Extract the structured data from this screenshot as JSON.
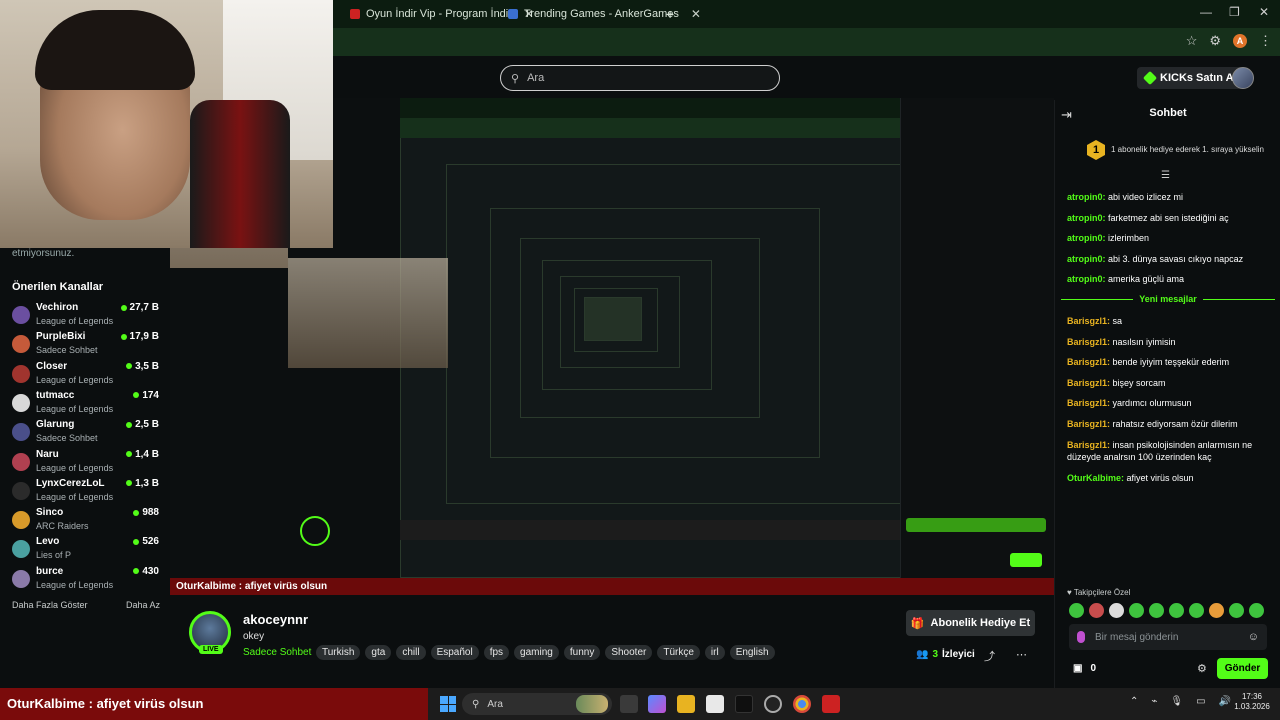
{
  "browser": {
    "tabs": [
      {
        "label": "Oyun İndir Vip - Program İndir",
        "close": "✕"
      },
      {
        "label": "Trending Games - AnkerGames",
        "close": "✕"
      }
    ],
    "new_tab": "+",
    "win_min": "—",
    "win_max": "❐",
    "win_close": "✕",
    "profile_initial": "A"
  },
  "header": {
    "search_placeholder": "Ara",
    "kicks_label": "KICKs Satın Al"
  },
  "sidebar": {
    "cut_text": "etmiyorsunuz.",
    "title": "Önerilen Kanallar",
    "channels": [
      {
        "name": "Vechiron",
        "game": "League of Legends",
        "viewers": "27,7 B",
        "color": "#6b4fa0"
      },
      {
        "name": "PurpleBixi",
        "game": "Sadece Sohbet",
        "viewers": "17,9 B",
        "color": "#c55a3a"
      },
      {
        "name": "Closer",
        "game": "League of Legends",
        "viewers": "3,5 B",
        "color": "#a0342e"
      },
      {
        "name": "tutmacc",
        "game": "League of Legends",
        "viewers": "174",
        "color": "#d8d8d8"
      },
      {
        "name": "Glarung",
        "game": "Sadece Sohbet",
        "viewers": "2,5 B",
        "color": "#4a4f8a"
      },
      {
        "name": "Naru",
        "game": "League of Legends",
        "viewers": "1,4 B",
        "color": "#b04050"
      },
      {
        "name": "LynxCerezLoL",
        "game": "League of Legends",
        "viewers": "1,3 B",
        "color": "#2b2b2b"
      },
      {
        "name": "Sinco",
        "game": "ARC Raiders",
        "viewers": "988",
        "color": "#d89a2a"
      },
      {
        "name": "Levo",
        "game": "Lies of P",
        "viewers": "526",
        "color": "#4aa0a0"
      },
      {
        "name": "burce",
        "game": "League of Legends",
        "viewers": "430",
        "color": "#8a7aa8"
      }
    ],
    "show_more": "Daha Fazla Göster",
    "show_less": "Daha Az"
  },
  "stream": {
    "overlay_text": "OturKalbime : afiyet virüs olsun"
  },
  "channel": {
    "name": "akoceynnr",
    "title": "okey",
    "live": "LIVE",
    "category": "Sadece Sohbet",
    "tags": [
      "Turkish",
      "gta",
      "chill",
      "Español",
      "fps",
      "gaming",
      "funny",
      "Shooter",
      "Türkçe",
      "irl",
      "English"
    ],
    "gift_label": "Abonelik Hediye Et",
    "viewer_count": "3",
    "viewer_label": "İzleyici"
  },
  "chat": {
    "title": "Sohbet",
    "pinned_badge": "1",
    "pinned_text": "1 abonelik hediye ederek 1. sıraya yükselin",
    "messages_before": [
      {
        "user": "atropin0",
        "text": "abi video izlicez mi"
      },
      {
        "user": "atropin0",
        "text": "farketmez abi sen istediğini aç"
      },
      {
        "user": "atropin0",
        "text": "izlerimben"
      },
      {
        "user": "atropin0",
        "text": "abi 3. dünya savası cıkıyo napcaz"
      },
      {
        "user": "atropin0",
        "text": "amerika güçlü ama"
      }
    ],
    "new_messages_label": "Yeni mesajlar",
    "messages_after": [
      {
        "user": "Barisgzl1",
        "text": "sa"
      },
      {
        "user": "Barisgzl1",
        "text": "nasılsın iyimisin"
      },
      {
        "user": "Barisgzl1",
        "text": "bende iyiyim teşşekür ederim"
      },
      {
        "user": "Barisgzl1",
        "text": "bişey sorcam"
      },
      {
        "user": "Barisgzl1",
        "text": "yardımcı olurmusun"
      },
      {
        "user": "Barisgzl1",
        "text": "rahatsız ediyorsam özür dilerim"
      },
      {
        "user": "Barisgzl1",
        "text": "insan psikolojisinden anlarmısın ne düzeyde analrsın 100 üzerinden kaç"
      },
      {
        "user": "OturKalbime",
        "text": "afiyet virüs olsun"
      }
    ],
    "favorites_label": "♥ Takipçilere Özel",
    "input_placeholder": "Bir mesaj gönderin",
    "kicks_count": "0",
    "send_label": "Gönder"
  },
  "taskbar": {
    "overlay_text": "OturKalbime : afiyet virüs olsun",
    "search_label": "Ara",
    "time": "17:36",
    "date": "1.03.2026"
  },
  "colors": {
    "accent": "#53fc18",
    "overlay_red": "#7a0b0b",
    "background": "#0b0e0f"
  }
}
